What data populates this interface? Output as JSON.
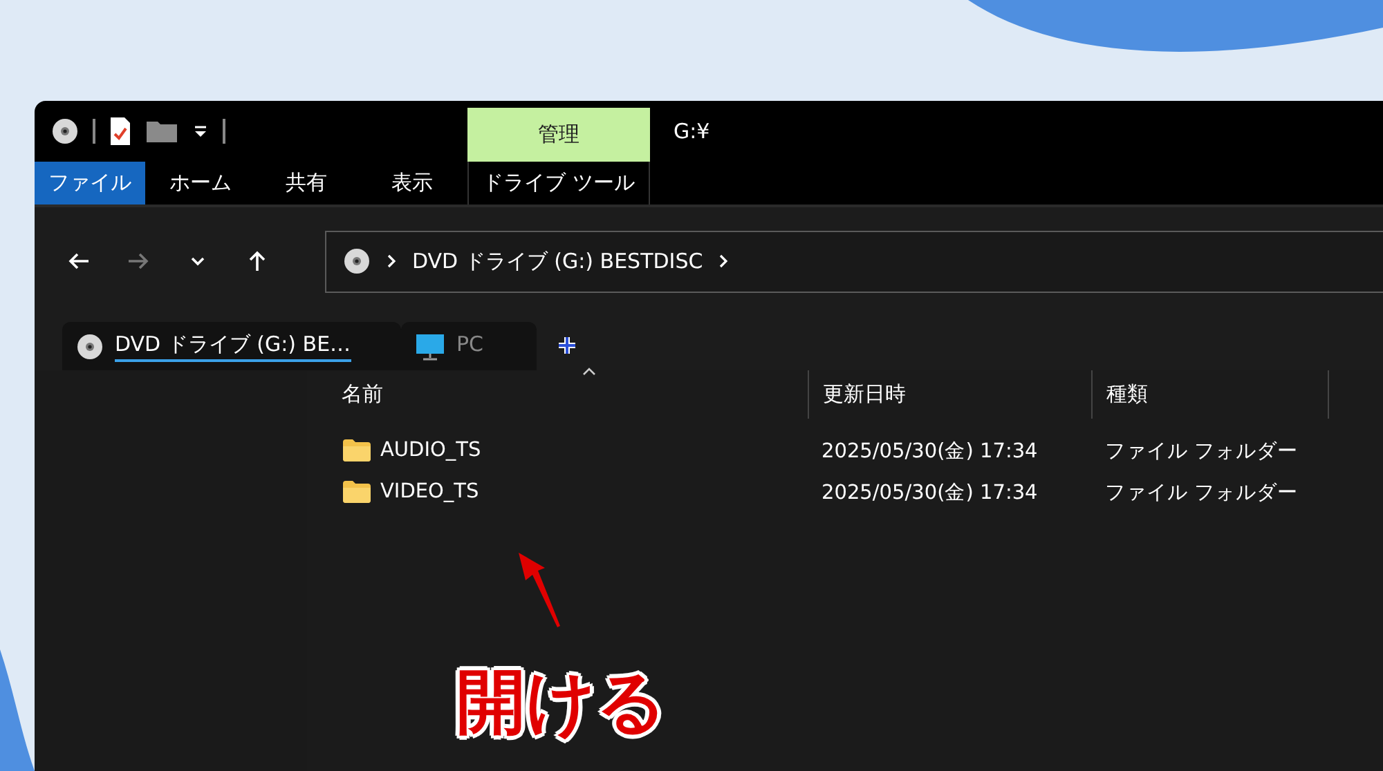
{
  "title_bar": {
    "contextual_group": "管理",
    "title": "G:¥"
  },
  "ribbon": {
    "tabs": [
      {
        "label": "ファイル",
        "selected": true
      },
      {
        "label": "ホーム",
        "selected": false
      },
      {
        "label": "共有",
        "selected": false
      },
      {
        "label": "表示",
        "selected": false
      }
    ],
    "contextual_tabs": [
      {
        "label": "ドライブ ツール",
        "selected": false
      }
    ]
  },
  "navigation": {
    "buttons": [
      {
        "kind": "back",
        "disabled": false
      },
      {
        "kind": "forward",
        "disabled": true
      },
      {
        "kind": "recent",
        "disabled": false
      },
      {
        "kind": "up",
        "disabled": false
      }
    ],
    "address": [
      "DVD ドライブ (G:) BESTDISC"
    ]
  },
  "tabs": [
    {
      "label": "DVD ドライブ (G:) BE…",
      "kind": "disc",
      "selected": true
    },
    {
      "label": "PC",
      "kind": "pc",
      "selected": false
    }
  ],
  "file_list": {
    "columns": [
      "名前",
      "更新日時",
      "種類"
    ],
    "rows": [
      {
        "name": "AUDIO_TS",
        "modified": "2025/05/30(金) 17:34",
        "type": "ファイル フォルダー"
      },
      {
        "name": "VIDEO_TS",
        "modified": "2025/05/30(金) 17:34",
        "type": "ファイル フォルダー"
      }
    ]
  },
  "annotation": {
    "text": "開ける"
  }
}
